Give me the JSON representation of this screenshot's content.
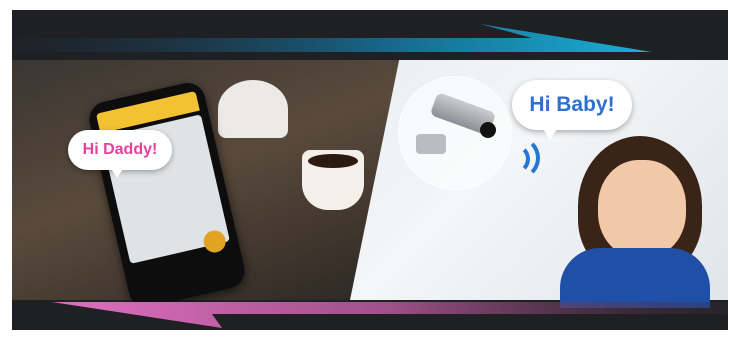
{
  "bubbles": {
    "left_text": "Hi Daddy!",
    "right_text": "Hi Baby!"
  },
  "colors": {
    "top_arrow": "#1aa0c8",
    "bottom_arrow": "#d35fb0",
    "daddy_text": "#e8419d",
    "baby_text": "#2f6fd0"
  }
}
